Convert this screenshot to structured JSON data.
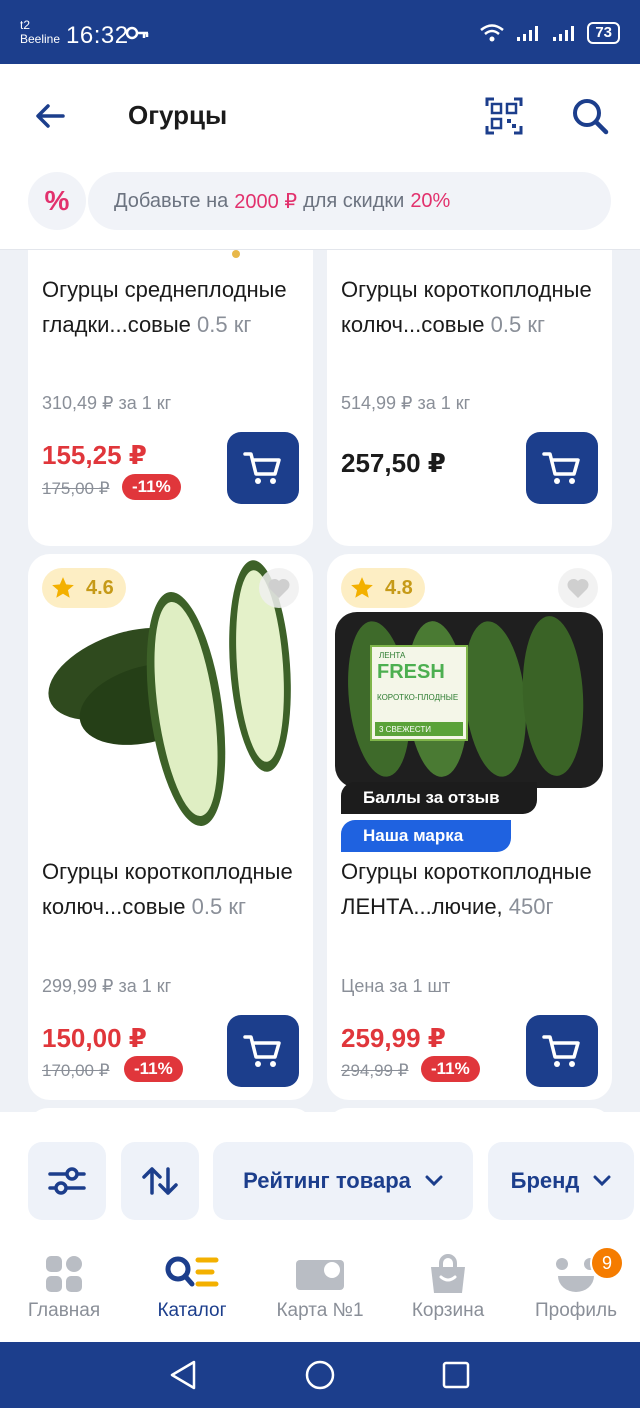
{
  "status_bar": {
    "carrier_line1": "t2",
    "carrier_line2": "Beeline",
    "time": "16:32",
    "battery": "73"
  },
  "header": {
    "title": "Огурцы"
  },
  "promo": {
    "icon_symbol": "%",
    "prefix": "Добавьте на",
    "amount": "2000 ₽",
    "middle": "для скидки",
    "percent": "20%"
  },
  "products": [
    {
      "name": "Огурцы среднеплодные гладки...совые",
      "weight": "0.5 кг",
      "unit_price": "310,49 ₽ за 1 кг",
      "price": "155,25 ₽",
      "old_price": "175,00 ₽",
      "discount": "-11%"
    },
    {
      "name": "Огурцы короткоплодные колюч...совые",
      "weight": "0.5 кг",
      "unit_price": "514,99 ₽ за 1 кг",
      "price": "257,50 ₽"
    },
    {
      "rating": "4.6",
      "name": "Огурцы короткоплодные колюч...совые",
      "weight": "0.5 кг",
      "unit_price": "299,99 ₽ за 1 кг",
      "price": "150,00 ₽",
      "old_price": "170,00 ₽",
      "discount": "-11%"
    },
    {
      "rating": "4.8",
      "badge_review": "Баллы за отзыв",
      "badge_brand": "Наша марка",
      "package_brand": "ЛЕНТА",
      "package_fresh": "FRESH",
      "package_label": "КОРОТКО-ПЛОДНЫЕ",
      "package_freshness": "3 СВЕЖЕСТИ",
      "name": "Огурцы короткоплодные ЛЕНТА...лючие,",
      "weight": "450г",
      "unit_price": "Цена за 1 шт",
      "price": "259,99 ₽",
      "old_price": "294,99 ₽",
      "discount": "-11%"
    }
  ],
  "filters": {
    "rating": "Рейтинг товара",
    "brand": "Бренд"
  },
  "bottom_nav": [
    {
      "label": "Главная"
    },
    {
      "label": "Каталог"
    },
    {
      "label": "Карта №1"
    },
    {
      "label": "Корзина"
    },
    {
      "label": "Профиль",
      "badge": "9"
    }
  ],
  "colors": {
    "brand": "#1c3e8c",
    "sale": "#e0363b",
    "promo": "#e2316d"
  }
}
